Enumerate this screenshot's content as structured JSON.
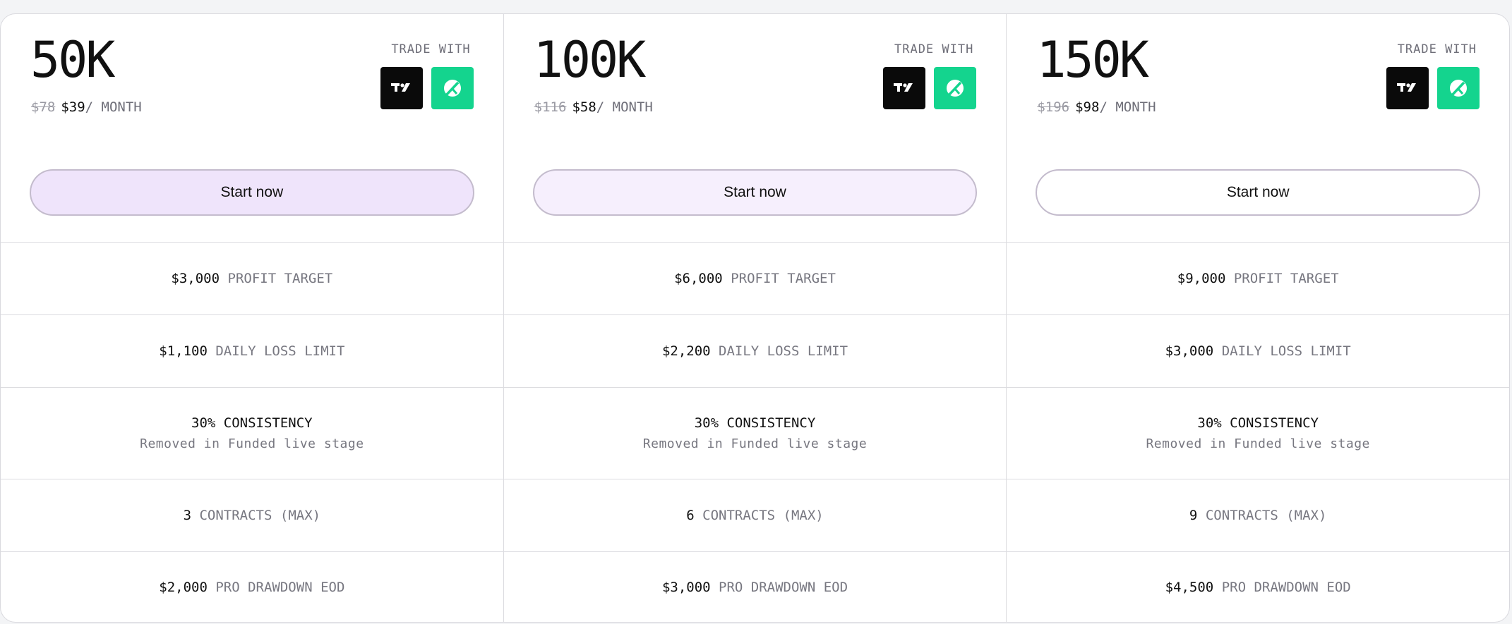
{
  "trade_with_label": "TRADE WITH",
  "per_month_label": "/ MONTH",
  "consistency_subtext": "Removed in Funded live stage",
  "labels": {
    "profit_target": "PROFIT TARGET",
    "daily_loss_limit": "DAILY LOSS LIMIT",
    "contracts": "CONTRACTS (MAX)",
    "drawdown": "PRO DRAWDOWN EOD"
  },
  "colors": {
    "platform_tv_bg": "#0a0a0a",
    "platform_leaf_bg": "#14d48e"
  },
  "plans": [
    {
      "size": "50K",
      "old_price": "$78",
      "price": "$39",
      "button_label": "Start now",
      "button_bg": "#efe4fb",
      "profit_target": "$3,000",
      "daily_loss_limit": "$1,100",
      "consistency": "30% CONSISTENCY",
      "contracts": "3",
      "drawdown": "$2,000",
      "platform_icons": [
        "tradingview-icon",
        "leaf-platform-icon"
      ]
    },
    {
      "size": "100K",
      "old_price": "$116",
      "price": "$58",
      "button_label": "Start now",
      "button_bg": "#f6effd",
      "profit_target": "$6,000",
      "daily_loss_limit": "$2,200",
      "consistency": "30% CONSISTENCY",
      "contracts": "6",
      "drawdown": "$3,000",
      "platform_icons": [
        "tradingview-icon",
        "leaf-platform-icon"
      ]
    },
    {
      "size": "150K",
      "old_price": "$196",
      "price": "$98",
      "button_label": "Start now",
      "button_bg": "#ffffff",
      "profit_target": "$9,000",
      "daily_loss_limit": "$3,000",
      "consistency": "30% CONSISTENCY",
      "contracts": "9",
      "drawdown": "$4,500",
      "platform_icons": [
        "tradingview-icon",
        "leaf-platform-icon"
      ]
    }
  ]
}
